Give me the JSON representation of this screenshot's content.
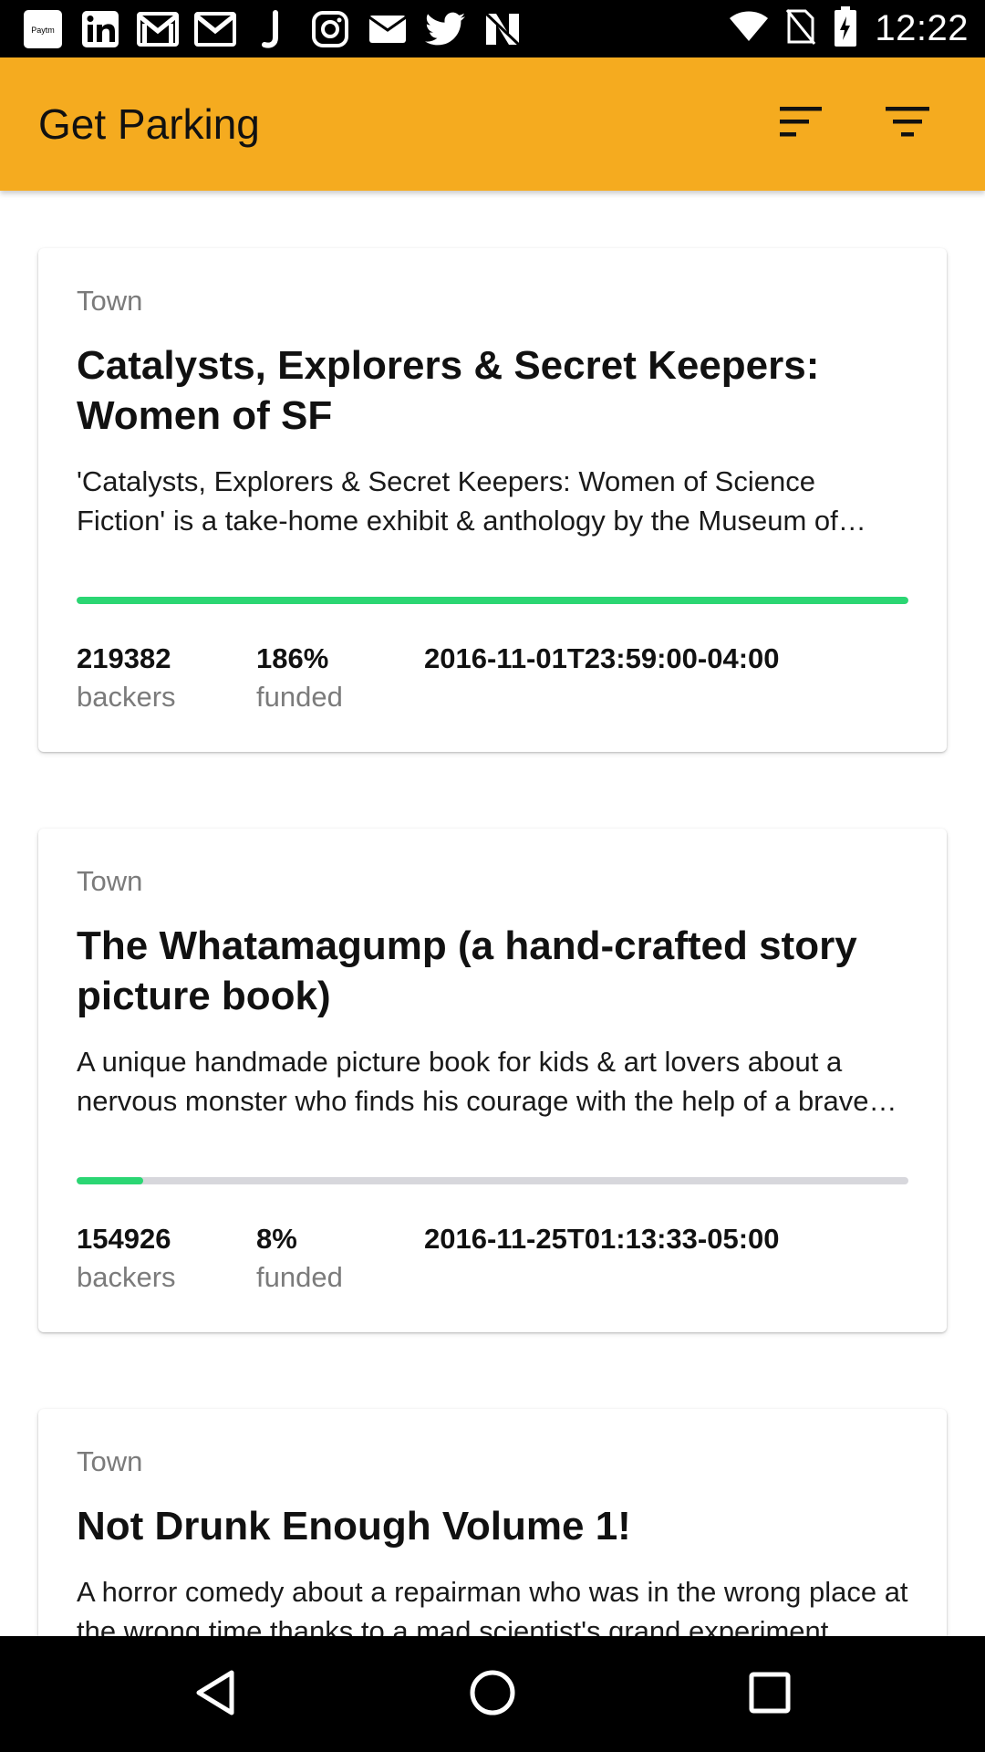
{
  "status_bar": {
    "time": "12:22",
    "paytm_label": "Paytm",
    "left_icons": [
      "paytm-icon",
      "linkedin-icon",
      "gmail-icon",
      "gmail-icon",
      "j-icon",
      "instagram-icon",
      "email-icon",
      "twitter-icon",
      "n-icon"
    ],
    "right_icons": [
      "wifi-icon",
      "no-sim-icon",
      "battery-icon"
    ]
  },
  "app_bar": {
    "title": "Get Parking",
    "actions": [
      "sort-icon",
      "filter-icon"
    ],
    "color": "#f5ab1f"
  },
  "projects": [
    {
      "category": "Town",
      "title": "Catalysts, Explorers & Secret Keepers: Women of SF",
      "blurb": "'Catalysts, Explorers & Secret Keepers: Women of Science Fiction' is a take-home exhibit & anthology by the Museum of Science Fiction.",
      "progress": 1.0,
      "backers": "219382",
      "backers_label": "backers",
      "funded": "186%",
      "funded_label": "funded",
      "deadline": "2016-11-01T23:59:00-04:00"
    },
    {
      "category": "Town",
      "title": "The Whatamagump (a hand-crafted story picture book)",
      "blurb": "A unique handmade picture book for kids & art lovers about a nervous monster who finds his courage with the help of a brave little girl.",
      "progress": 0.08,
      "backers": "154926",
      "backers_label": "backers",
      "funded": "8%",
      "funded_label": "funded",
      "deadline": "2016-11-25T01:13:33-05:00"
    },
    {
      "category": "Town",
      "title": "Not Drunk Enough Volume 1!",
      "blurb": "A horror comedy about a repairman who was in the wrong place at the wrong time thanks to a mad scientist's grand experiment."
    }
  ],
  "colors": {
    "progress_fill": "#2bd673",
    "progress_track": "#d7d7dc"
  },
  "nav_bar": {
    "buttons": [
      "back-icon",
      "home-icon",
      "recents-icon"
    ]
  }
}
